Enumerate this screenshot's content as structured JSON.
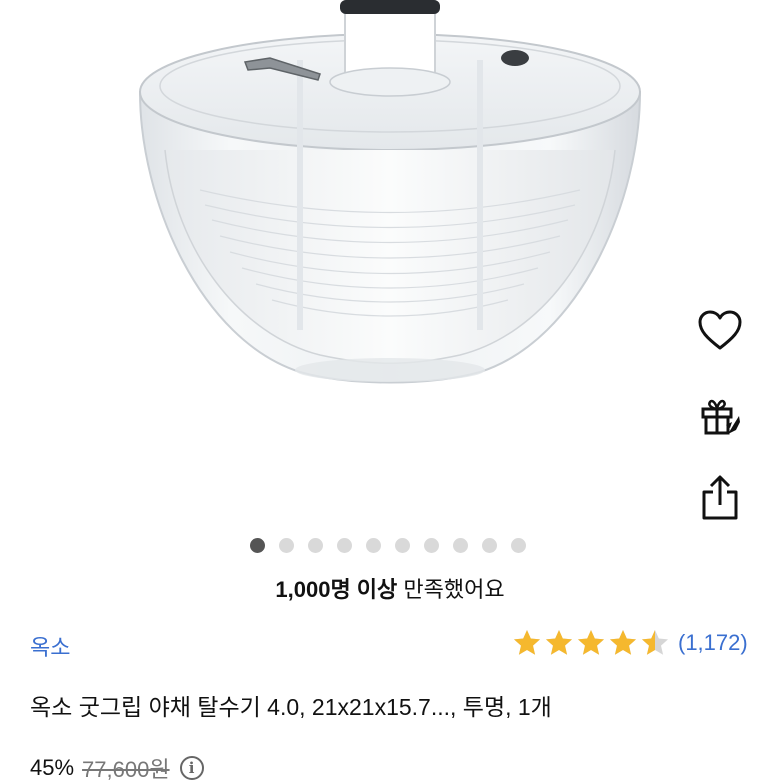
{
  "product_image": {
    "icon": "salad-spinner-photo"
  },
  "actions": {
    "like_icon": "heart-icon",
    "gift_icon": "gift-icon",
    "share_icon": "share-icon"
  },
  "carousel": {
    "total": 10,
    "active_index": 0
  },
  "satisfaction": {
    "strong": "1,000명 이상",
    "rest": " 만족했어요"
  },
  "brand": "옥소",
  "rating": {
    "stars": 4.5,
    "count_text": "(1,172)",
    "star_color": "#f5b82e"
  },
  "product": {
    "title": "옥소 굿그립 야채 탈수기 4.0, 21x21x15.7..., 투명, 1개"
  },
  "price": {
    "discount": "45%",
    "original": "77,600원",
    "info_icon": "info-icon",
    "info_glyph": "i"
  },
  "colors": {
    "link": "#3a6fd0",
    "dot_active": "#555555",
    "dot_inactive": "#d9d9d9"
  }
}
